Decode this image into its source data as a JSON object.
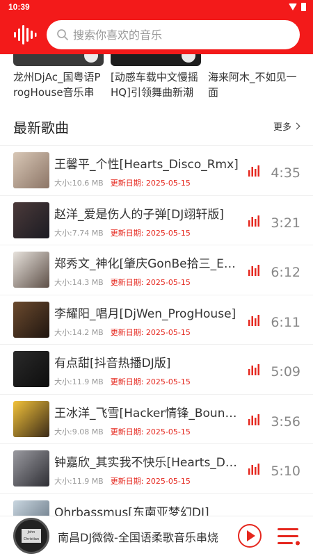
{
  "status": {
    "time": "10:39"
  },
  "search": {
    "placeholder": "搜索你喜欢的音乐"
  },
  "top_cards": [
    {
      "title": "龙州DjAc_国粤语ProgHouse音乐串烧"
    },
    {
      "title": "[动感车载中文慢摇HQ]引领舞曲新潮流"
    },
    {
      "title": "海来阿木_不如见一面"
    }
  ],
  "section": {
    "title": "最新歌曲",
    "more": "更多"
  },
  "songs": [
    {
      "title": "王馨平_个性[Hearts_Disco_Rmx]",
      "size": "大小:10.6 MB",
      "date": "更新日期: 2025-05-15",
      "duration": "4:35"
    },
    {
      "title": "赵洋_爱是伤人的子弹[DJ翊轩版]",
      "size": "大小:7.74 MB",
      "date": "更新日期: 2025-05-15",
      "duration": "3:21"
    },
    {
      "title": "郑秀文_神化[肇庆GonBe拾三_Edit]",
      "size": "大小:14.3 MB",
      "date": "更新日期: 2025-05-15",
      "duration": "6:12"
    },
    {
      "title": "李耀阳_唱月[DjWen_ProgHouse]",
      "size": "大小:14.2 MB",
      "date": "更新日期: 2025-05-15",
      "duration": "6:11"
    },
    {
      "title": "有点甜[抖音热播DJ版]",
      "size": "大小:11.9 MB",
      "date": "更新日期: 2025-05-15",
      "duration": "5:09"
    },
    {
      "title": "王冰洋_飞雪[Hacker情锋_Bounce]",
      "size": "大小:9.08 MB",
      "date": "更新日期: 2025-05-15",
      "duration": "3:56"
    },
    {
      "title": "钟嘉欣_其实我不快乐[Hearts_Disco]",
      "size": "大小:11.9 MB",
      "date": "更新日期: 2025-05-15",
      "duration": "5:10"
    },
    {
      "title": "Ohrbassmus[东南亚梦幻DJ]",
      "size": "",
      "date": "",
      "duration": ""
    }
  ],
  "player": {
    "title": "南昌DJ微微-全国语柔歌音乐串烧",
    "disc_label": "John Christian"
  },
  "colors": {
    "accent": "#f31a1a",
    "date": "#e5271e"
  }
}
